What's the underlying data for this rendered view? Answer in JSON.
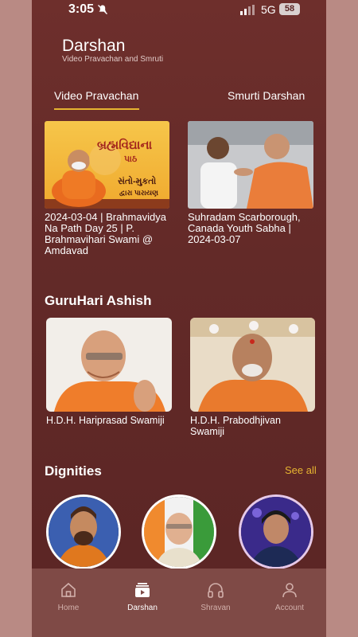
{
  "status": {
    "time": "3:05",
    "network": "5G",
    "battery": "58"
  },
  "header": {
    "title": "Darshan",
    "subtitle": "Video Pravachan and Smruti"
  },
  "tabs": [
    {
      "label": "Video Pravachan",
      "active": true
    },
    {
      "label": "Smurti Darshan",
      "active": false
    }
  ],
  "videos": [
    {
      "caption": "2024-03-04 | Brahmavidya Na Path Day 25 | P. Brahmavihari Swami @ Amdavad",
      "image_text": "બ્રહ્મવિદ્યાના",
      "image_text2": "પાઠ",
      "image_text3": "સંતો-મુકતો",
      "image_text4": "દ્વારા પારાયણ"
    },
    {
      "caption": "Suhradam Scarborough, Canada Youth Sabha | 2024-03-07"
    }
  ],
  "guruhari": {
    "title": "GuruHari Ashish",
    "items": [
      {
        "name": "H.D.H. Hariprasad Swamiji"
      },
      {
        "name": "H.D.H. Prabodhjivan Swamiji"
      }
    ]
  },
  "dignities": {
    "title": "Dignities",
    "see_all": "See all"
  },
  "nav": [
    {
      "label": "Home",
      "icon": "home-icon",
      "active": false
    },
    {
      "label": "Darshan",
      "icon": "video-icon",
      "active": true
    },
    {
      "label": "Shravan",
      "icon": "headphones-icon",
      "active": false
    },
    {
      "label": "Account",
      "icon": "person-icon",
      "active": false
    }
  ],
  "colors": {
    "background": "#632a28",
    "accent": "#e6b431",
    "nav": "#7f4a46"
  }
}
